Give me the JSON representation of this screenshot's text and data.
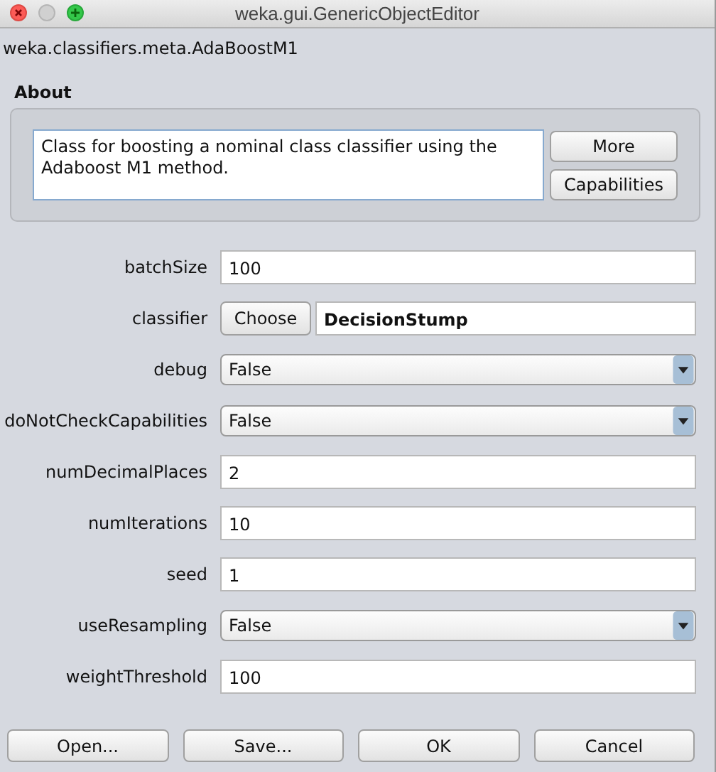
{
  "window": {
    "title": "weka.gui.GenericObjectEditor"
  },
  "class_name": "weka.classifiers.meta.AdaBoostM1",
  "about": {
    "heading": "About",
    "description": "Class for boosting a nominal class classifier using the Adaboost M1 method.",
    "buttons": [
      "More",
      "Capabilities"
    ]
  },
  "properties": [
    {
      "kind": "text",
      "label": "batchSize",
      "value": "100"
    },
    {
      "kind": "choose",
      "label": "classifier",
      "button": "Choose",
      "value": "DecisionStump"
    },
    {
      "kind": "dropdown",
      "label": "debug",
      "value": "False"
    },
    {
      "kind": "dropdown",
      "label": "doNotCheckCapabilities",
      "value": "False"
    },
    {
      "kind": "text",
      "label": "numDecimalPlaces",
      "value": "2"
    },
    {
      "kind": "text",
      "label": "numIterations",
      "value": "10"
    },
    {
      "kind": "text",
      "label": "seed",
      "value": "1"
    },
    {
      "kind": "dropdown",
      "label": "useResampling",
      "value": "False"
    },
    {
      "kind": "text",
      "label": "weightThreshold",
      "value": "100"
    }
  ],
  "buttons": [
    "Open...",
    "Save...",
    "OK",
    "Cancel"
  ]
}
